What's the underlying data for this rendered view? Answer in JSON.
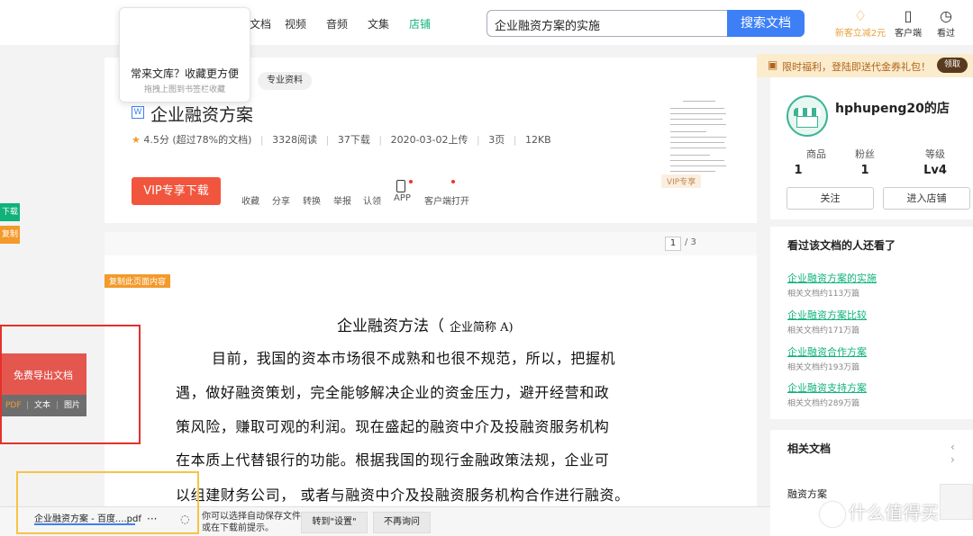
{
  "nav": {
    "items": [
      "文档",
      "视频",
      "音频",
      "文集",
      "店铺"
    ],
    "active_index": 4
  },
  "search": {
    "value": "企业融资方案的实施",
    "button": "搜索文档"
  },
  "header_icons": {
    "vip": "新客立减2元",
    "client": "客户端",
    "history": "看过"
  },
  "popup": {
    "title": "常来文库？收藏更方便",
    "subtitle": "拖拽上图到书签栏收藏"
  },
  "doc": {
    "tag": "专业资料",
    "type_icon": "W",
    "title": "企业融资方案",
    "rating": "4.5分",
    "rating_note": "(超过78%的文档)",
    "reads": "3328阅读",
    "downloads": "37下载",
    "upload_date": "2020-03-02上传",
    "pages": "3页",
    "size": "12KB",
    "vip_download": "VIP专享下载",
    "actions": [
      "收藏",
      "分享",
      "转换",
      "举报",
      "认领",
      "APP",
      "客户端打开"
    ],
    "vip_tag": "VIP专享"
  },
  "pager": {
    "current": "1",
    "total": "/ 3"
  },
  "content": {
    "copy_label": "复制此页面内容",
    "heading": "企业融资方法（",
    "heading_sub": "企业简称   A)",
    "lines": [
      "目前，我国的资本市场很不成熟和也很不规范，所以，把握机",
      "遇，做好融资策划，完全能够解决企业的资金压力，避开经营和政",
      "策风险，赚取可观的利润。现在盛起的融资中介及投融资服务机构",
      "在本质上代替银行的功能。根据我国的现行金融政策法规，企业可",
      "以组建财务公司，  或者与融资中介及投融资服务机构合作进行融资。"
    ]
  },
  "side_tabs": {
    "download": "下载",
    "copy": "复制"
  },
  "export": {
    "title": "免费导出文档",
    "options": [
      "PDF",
      "文本",
      "图片"
    ]
  },
  "promo": {
    "text": "限时福利，登陆即送代金券礼包！",
    "claim": "领取"
  },
  "shop": {
    "name": "hphupeng20的店",
    "stats": [
      {
        "label": "商品",
        "value": "1"
      },
      {
        "label": "粉丝",
        "value": "1"
      },
      {
        "label": "等级",
        "value": "Lv4"
      }
    ],
    "follow": "关注",
    "enter": "进入店铺"
  },
  "viewed": {
    "title": "看过该文档的人还看了",
    "items": [
      {
        "title": "企业融资方案的实施",
        "sub": "相关文档约113万篇"
      },
      {
        "title": "企业融资方案比较",
        "sub": "相关文档约171万篇"
      },
      {
        "title": "企业融资合作方案",
        "sub": "相关文档约193万篇"
      },
      {
        "title": "企业融资支持方案",
        "sub": "相关文档约289万篇"
      }
    ]
  },
  "related": {
    "title": "相关文档",
    "arrows": "‹ ›",
    "item": "融资方案"
  },
  "download_bar": {
    "file": "企业融资方案 - 百度....pdf",
    "more": "···",
    "message": "你可以选择自动保存文件或在下载前提示。",
    "settings_btn": "转到\"设置\"",
    "ask_btn": "不再询问"
  },
  "watermark": "什么值得买"
}
